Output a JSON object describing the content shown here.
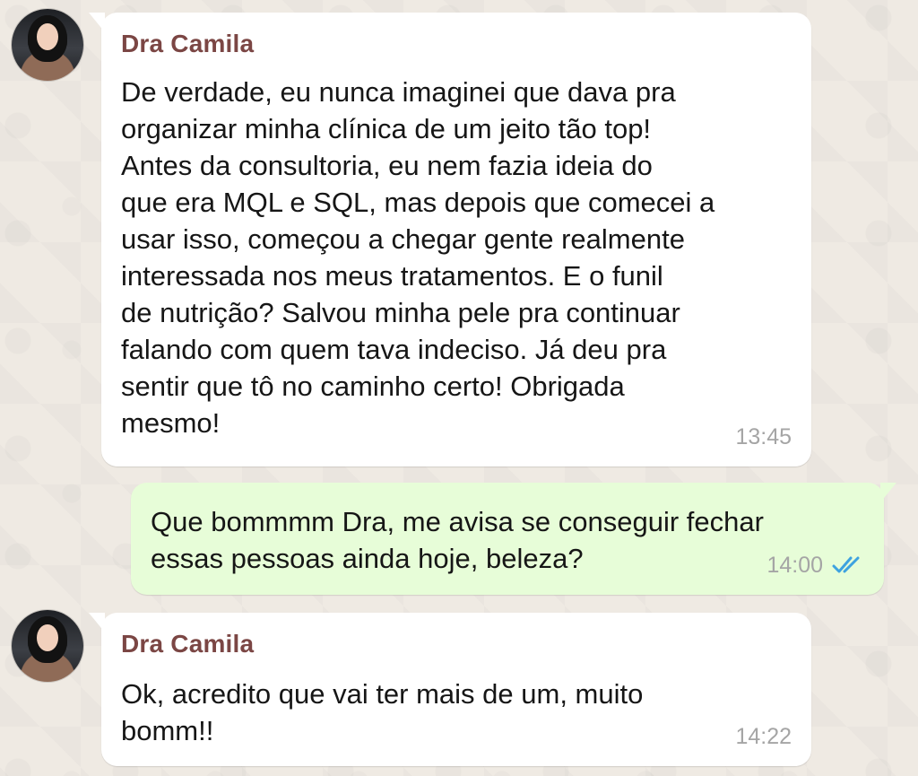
{
  "messages": [
    {
      "sender": "Dra Camila",
      "text": "De verdade, eu nunca imaginei que dava pra\norganizar minha clínica de um jeito tão top!\nAntes da consultoria, eu nem fazia ideia do\nque era MQL e SQL, mas depois que comecei a\nusar isso, começou a chegar gente realmente\ninteressada nos meus tratamentos. E o funil\nde nutrição? Salvou minha pele pra continuar\nfalando com quem tava indeciso. Já deu pra\nsentir que tô no caminho certo! Obrigada\nmesmo!",
      "time": "13:45"
    },
    {
      "text": "Que bommmm Dra, me avisa se conseguir fechar\nessas pessoas ainda hoje, beleza?",
      "time": "14:00",
      "status_icon": "double-check-icon",
      "status_color": "#3ea2e0"
    },
    {
      "sender": "Dra Camila",
      "text": "Ok, acredito que vai ter mais de um, muito\nbomm!!",
      "time": "14:22"
    }
  ]
}
